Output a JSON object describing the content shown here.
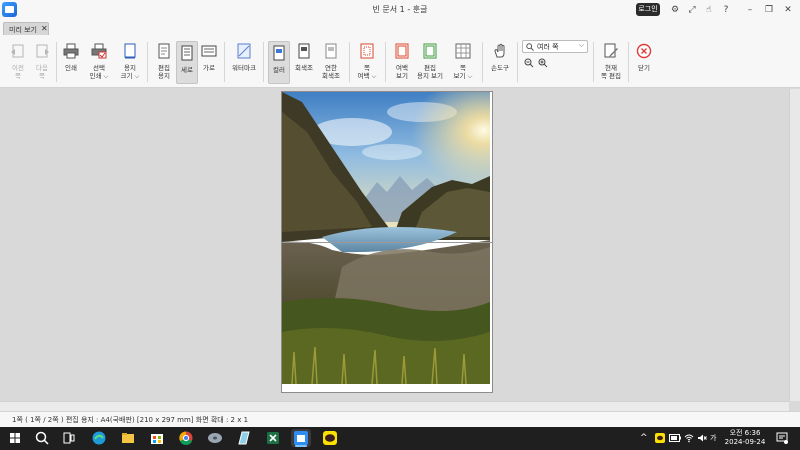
{
  "window": {
    "title": "빈 문서 1 - 훈글",
    "login_label": "로그인",
    "icons": [
      "gear-icon",
      "expand-icon",
      "hand-icon",
      "help-icon",
      "minimize-icon",
      "restore-icon",
      "close-icon"
    ]
  },
  "doc_tab": {
    "label": "미리 보기",
    "close": "✕"
  },
  "ribbon": {
    "prev_page": "이전\n쪽",
    "next_page": "다음\n쪽",
    "print": "인쇄",
    "select_print": "선택\n인쇄 ⌵",
    "paper_size": "용지\n크기 ⌵",
    "edit_paper": "편집\n용지",
    "portrait": "세로",
    "landscape": "가로",
    "watermark": "워터마크",
    "color": "컬러",
    "grayscale": "회색조",
    "light_grayscale": "연한\n회색조",
    "page_margin": "쪽\n여백 ⌵",
    "show_margin": "여백\n보기",
    "show_edit_paper": "편집\n용지 보기",
    "page_view": "쪽\n보기 ⌵",
    "hand_tool": "손도구",
    "zoom_mode": "여러 쪽",
    "current_page_edit": "현재\n쪽 편집",
    "close": "닫기"
  },
  "statusbar": {
    "text": "1쪽 ( 1쪽 / 2쪽 ) 편집 용지 : A4(국배판) [210 x 297 mm] 화면 확대 : 2 x 1"
  },
  "taskbar": {
    "tray_kor": "가",
    "clock_time": "오전 6:36",
    "clock_date": "2024-09-24"
  },
  "colors": {
    "accent": "#1c66d6",
    "close_red": "#e03b3b",
    "taskbar": "#1f1f1f"
  }
}
